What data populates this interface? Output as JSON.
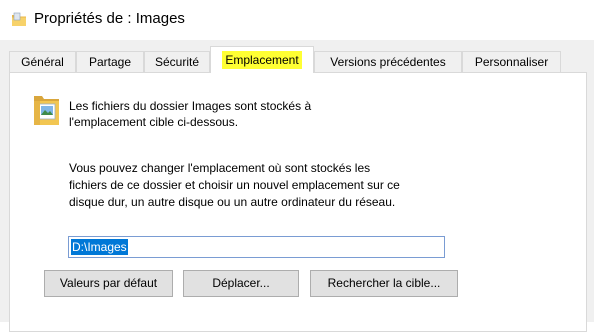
{
  "window": {
    "title": "Propriétés de : Images"
  },
  "tabs": [
    {
      "label": "Général",
      "active": false
    },
    {
      "label": "Partage",
      "active": false
    },
    {
      "label": "Sécurité",
      "active": false
    },
    {
      "label": "Emplacement",
      "active": true
    },
    {
      "label": "Versions précédentes",
      "active": false
    },
    {
      "label": "Personnaliser",
      "active": false
    }
  ],
  "location": {
    "info_line1": "Les fichiers du dossier Images sont stockés à",
    "info_line2": "l'emplacement cible ci-dessous.",
    "desc_line1": "Vous pouvez changer l'emplacement où sont stockés les",
    "desc_line2": "fichiers de ce dossier et choisir un nouvel emplacement sur ce",
    "desc_line3": "disque dur, un autre disque ou un autre ordinateur du réseau.",
    "path_value": "D:\\Images"
  },
  "buttons": {
    "restore_default": "Valeurs par défaut",
    "move": "Déplacer...",
    "find_target": "Rechercher la cible..."
  },
  "colors": {
    "highlight": "#ffff33",
    "selection": "#0078d7",
    "dialog_bg": "#f0f0f0",
    "button_bg": "#e1e1e1"
  },
  "icons": {
    "title": "folder-pictures-icon",
    "content": "folder-pictures-icon"
  }
}
